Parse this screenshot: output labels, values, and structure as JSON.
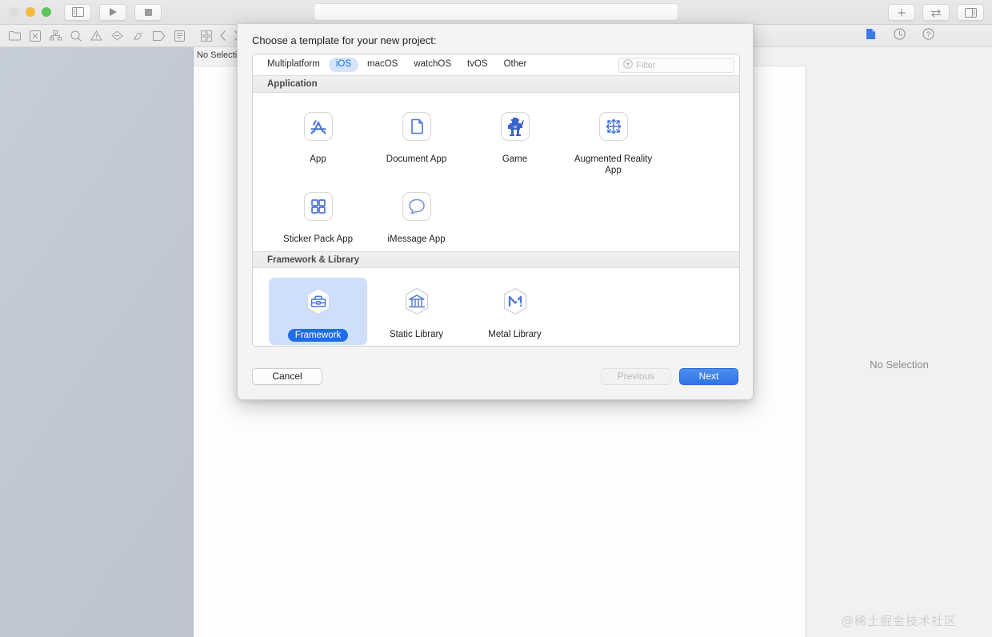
{
  "titlebar": {
    "traffic_lights": [
      "close",
      "minimize",
      "zoom"
    ],
    "buttons": [
      {
        "name": "sidebar-toggle",
        "icon": "sidebar-icon"
      },
      {
        "name": "run",
        "icon": "play-icon"
      },
      {
        "name": "stop",
        "icon": "stop-icon"
      }
    ],
    "right_buttons": [
      {
        "name": "add",
        "icon": "plus-icon"
      },
      {
        "name": "swap-editors",
        "icon": "swap-arrows-icon"
      },
      {
        "name": "inspector-toggle",
        "icon": "right-panel-icon"
      }
    ]
  },
  "navigator": {
    "toolbar_icons": [
      "folder-icon",
      "source-control-icon",
      "symbol-hierarchy-icon",
      "search-icon",
      "warning-triangle-icon",
      "breakpoint-icon",
      "debug-icon",
      "tag-icon",
      "report-icon"
    ]
  },
  "jumpbar": {
    "grid_icon": "grid-icon",
    "back_icon": "chevron-left-icon",
    "forward_icon": "chevron-right-icon",
    "breadcrumb": "No Selection"
  },
  "inspector": {
    "tabs": [
      {
        "name": "file-inspector",
        "icon": "file-icon",
        "active": true
      },
      {
        "name": "history-inspector",
        "icon": "clock-icon",
        "active": false
      },
      {
        "name": "quick-help-inspector",
        "icon": "question-mark-icon",
        "active": false
      }
    ],
    "empty_state": "No Selection",
    "watermark": "@稀土掘金技术社区"
  },
  "dialog": {
    "title": "Choose a template for your new project:",
    "platform_tabs": [
      {
        "label": "Multiplatform",
        "active": false
      },
      {
        "label": "iOS",
        "active": true
      },
      {
        "label": "macOS",
        "active": false
      },
      {
        "label": "watchOS",
        "active": false
      },
      {
        "label": "tvOS",
        "active": false
      },
      {
        "label": "Other",
        "active": false
      }
    ],
    "filter": {
      "placeholder": "Filter",
      "value": "",
      "icon": "filter-icon"
    },
    "sections": [
      {
        "header": "Application",
        "templates": [
          {
            "label": "App",
            "icon": "appstore-a-icon",
            "selected": false
          },
          {
            "label": "Document App",
            "icon": "document-page-icon",
            "selected": false
          },
          {
            "label": "Game",
            "icon": "game-character-icon",
            "selected": false
          },
          {
            "label": "Augmented Reality App",
            "icon": "ar-arrows-icon",
            "selected": false
          },
          {
            "label": "Sticker Pack App",
            "icon": "sticker-grid-icon",
            "selected": false
          },
          {
            "label": "iMessage App",
            "icon": "speech-bubble-icon",
            "selected": false
          }
        ]
      },
      {
        "header": "Framework & Library",
        "templates": [
          {
            "label": "Framework",
            "icon": "toolbox-hexagon-icon",
            "selected": true
          },
          {
            "label": "Static Library",
            "icon": "bank-hexagon-icon",
            "selected": false
          },
          {
            "label": "Metal Library",
            "icon": "metal-m-hexagon-icon",
            "selected": false
          }
        ]
      }
    ],
    "buttons": {
      "cancel": "Cancel",
      "previous": "Previous",
      "next": "Next"
    }
  },
  "colors": {
    "accent_blue": "#1d6ee8",
    "tab_active_bg": "#d4e4fd",
    "selection_bg": "#cfdffb",
    "icon_blue": "#4a74d8"
  }
}
